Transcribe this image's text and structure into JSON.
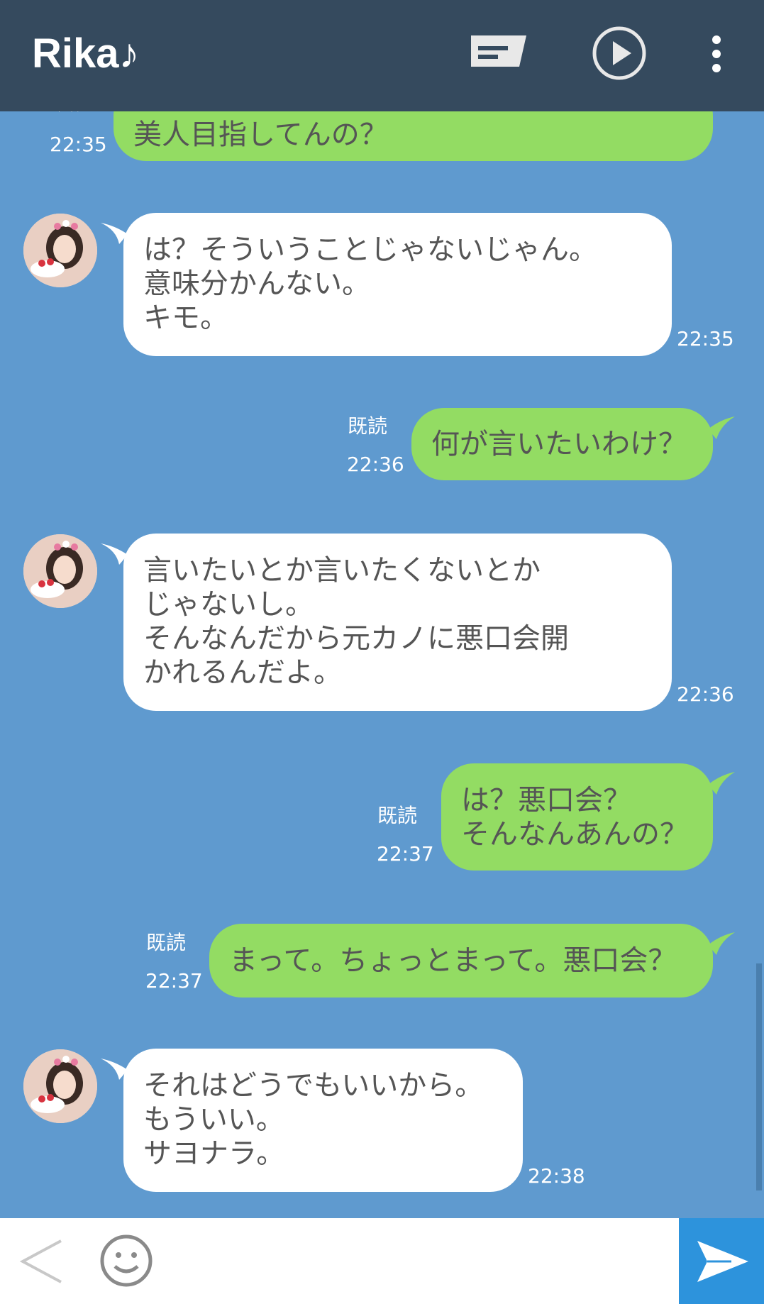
{
  "header": {
    "title": "Rika♪",
    "icons": [
      "note-icon",
      "play-icon",
      "more-vert-icon"
    ]
  },
  "messages": [
    {
      "id": "m1",
      "side": "sent",
      "text": "美人目指してんの？",
      "read": "既読",
      "time": "22:35"
    },
    {
      "id": "m2",
      "side": "received",
      "text": "は？そういうことじゃないじゃん。\n意味分かんない。\nキモ。",
      "time": "22:35"
    },
    {
      "id": "m3",
      "side": "sent",
      "text": "何が言いたいわけ？",
      "read": "既読",
      "time": "22:36"
    },
    {
      "id": "m4",
      "side": "received",
      "text": "言いたいとか言いたくないとか\nじゃないし。\nそんなんだから元カノに悪口会開\nかれるんだよ。",
      "time": "22:36"
    },
    {
      "id": "m5",
      "side": "sent",
      "text": "は？悪口会？\nそんなんあんの？",
      "read": "既読",
      "time": "22:37"
    },
    {
      "id": "m6",
      "side": "sent",
      "text": "まって。ちょっとまって。悪口会？",
      "read": "既読",
      "time": "22:37"
    },
    {
      "id": "m7",
      "side": "received",
      "text": "それはどうでもいいから。\nもういい。\nサヨナラ。",
      "time": "22:38"
    }
  ],
  "bottombar": {
    "icons": [
      "back-icon",
      "emoji-icon",
      "send-icon"
    ]
  },
  "colors": {
    "header": "#354a5e",
    "chat_background": "#5f9acf",
    "sent_bubble": "#93dc63",
    "received_bubble": "#ffffff",
    "send_button": "#2d93dc"
  }
}
